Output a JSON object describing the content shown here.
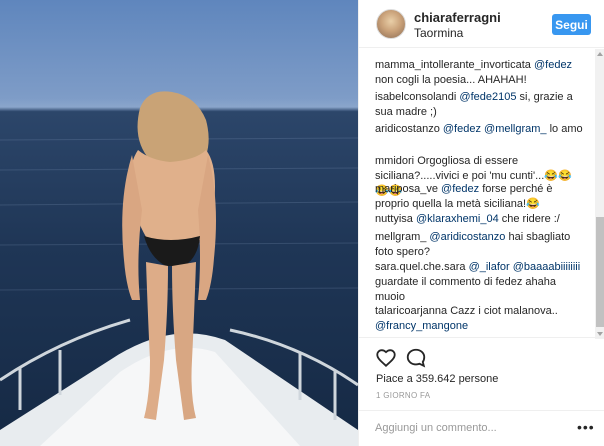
{
  "post": {
    "username": "chiaraferragni",
    "location": "Taormina",
    "follow_label": "Segui"
  },
  "comments": [
    {
      "user": "mamma_intollerante_invorticata",
      "mention": "@fedez",
      "text": "non cogli la poesia... AHAHAH!"
    },
    {
      "user": "isabelconsolandi",
      "mention": "@fede2105",
      "text": "si, grazie a sua madre ;)"
    },
    {
      "user": "aridicostanzo",
      "mention": "@fedez @mellgram_",
      "text": "lo amo"
    },
    {
      "user": "mmidori",
      "mention": "",
      "text": "Orgogliosa di essere siciliana?.....vivici e poi 'mu cunti'...😂😂😂😂"
    },
    {
      "user": "mariposa_ve",
      "mention": "@fedez",
      "text": "forse perché è proprio quella la metà siciliana!😂"
    },
    {
      "user": "nuttyisa",
      "mention": "@klaraxhemi_04",
      "text": "che ridere :/"
    },
    {
      "user": "mellgram_",
      "mention": "@aridicostanzo",
      "text": "hai sbagliato foto spero?"
    },
    {
      "user": "sara.quel.che.sara",
      "mention": "@_ilafor @baaaabiiiiiiii",
      "text": "guardate il commento di fedez ahaha muoio"
    },
    {
      "user": "talaricoarjanna",
      "mention": "",
      "text": "Cazz i ciot malanova..",
      "mention_after": "@francy_mangone"
    }
  ],
  "actions": {
    "likes": "Piace a 359.642 persone",
    "time": "1 GIORNO FA",
    "comment_placeholder": "Aggiungi un commento...",
    "more": "•••"
  },
  "icons": {
    "like": "heart-icon",
    "comment": "comment-bubble-icon",
    "more": "more-options-icon"
  },
  "colors": {
    "follow_button": "#3897f0",
    "mention": "#003569",
    "text": "#262626",
    "muted": "#999999"
  }
}
